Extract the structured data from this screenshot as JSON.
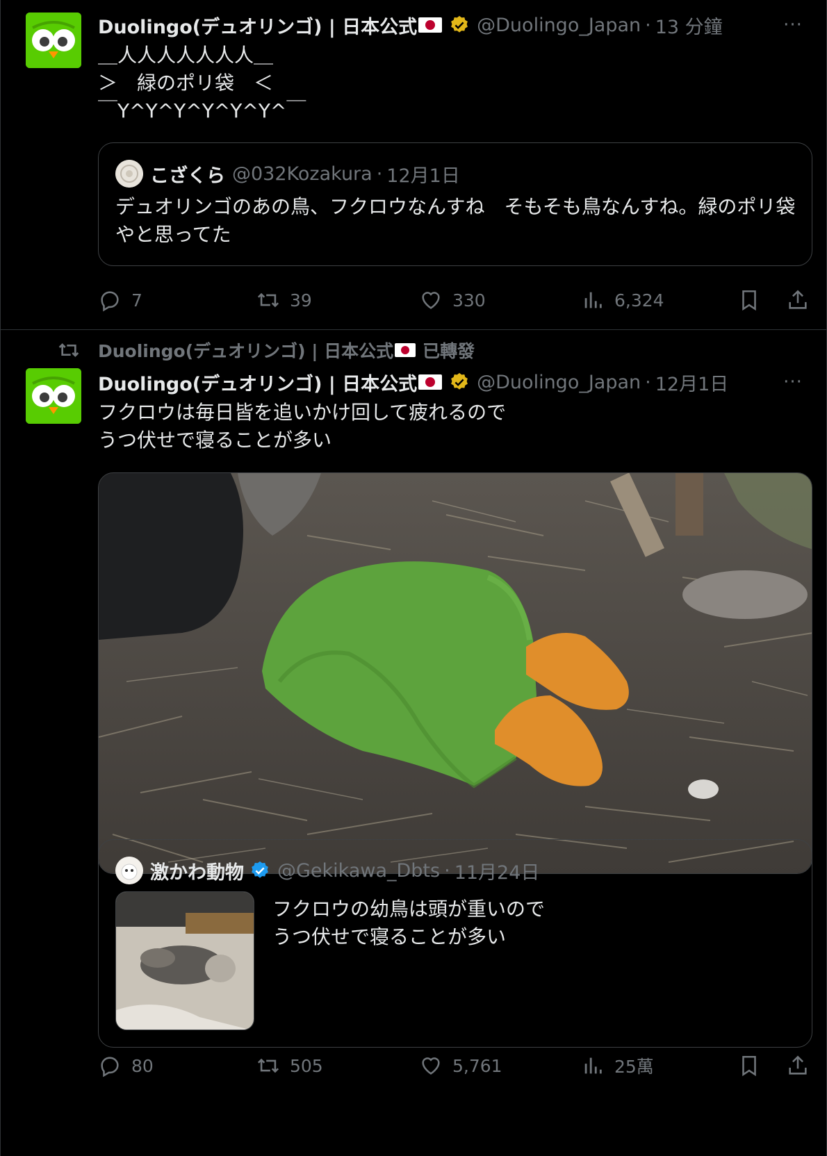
{
  "colors": {
    "background": "#000000",
    "text": "#e7e9ea",
    "muted": "#71767b",
    "border": "#2f3336",
    "verified_gold": "#e2b719",
    "verified_blue": "#1d9bf0",
    "duo_green": "#58cc02"
  },
  "tweet1": {
    "author_name": "Duolingo(デュオリンゴ) | 日本公式",
    "handle": "@Duolingo_Japan",
    "separator": "·",
    "time": "13 分鐘",
    "more_label": "···",
    "body": "＿人人人人人人人＿\n＞　緑のポリ袋　＜\n￣Y^Y^Y^Y^Y^Y^￣",
    "quote": {
      "author_name": "こざくら",
      "handle": "@032Kozakura",
      "separator": "·",
      "time": "12月1日",
      "text": "デュオリンゴのあの鳥、フクロウなんすね　そもそも鳥なんすね。緑のポリ袋やと思ってた"
    },
    "actions": {
      "replies": "7",
      "retweets": "39",
      "likes": "330",
      "views": "6,324"
    }
  },
  "tweet2": {
    "retweeted_by": "Duolingo(デュオリンゴ) | 日本公式",
    "retweet_label": "已轉發",
    "author_name": "Duolingo(デュオリンゴ) | 日本公式",
    "handle": "@Duolingo_Japan",
    "separator": "·",
    "time": "12月1日",
    "more_label": "···",
    "body": "フクロウは毎日皆を追いかけ回して疲れるので\nうつ伏せで寝ることが多い",
    "quote": {
      "author_name": "激かわ動物",
      "handle": "@Gekikawa_Dbts",
      "separator": "·",
      "time": "11月24日",
      "text": "フクロウの幼鳥は頭が重いので\nうつ伏せで寝ることが多い"
    },
    "actions": {
      "replies": "80",
      "retweets": "505",
      "likes": "5,761",
      "views": "25萬"
    }
  },
  "icons": {
    "avatar": "duolingo-owl-icon",
    "verified": "verified-badge-icon",
    "reply": "reply-icon",
    "retweet": "retweet-icon",
    "like": "heart-icon",
    "views": "views-chart-icon",
    "bookmark": "bookmark-icon",
    "share": "share-icon"
  }
}
